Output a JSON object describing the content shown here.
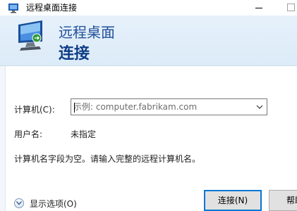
{
  "window": {
    "title": "远程桌面连接"
  },
  "banner": {
    "line1": "远程桌面",
    "line2": "连接"
  },
  "form": {
    "computer_label": "计算机(C):",
    "computer_placeholder": "示例: computer.fabrikam.com",
    "computer_value": "",
    "username_label": "用户名:",
    "username_value": "未指定",
    "status_message": "计算机名字段为空。请输入完整的远程计算机名。"
  },
  "footer": {
    "show_options_label": "显示选项(O)",
    "connect_label": "连接(N)",
    "help_label": "帮助"
  },
  "colors": {
    "accent": "#0078d7",
    "banner_text": "#1f4f99"
  }
}
